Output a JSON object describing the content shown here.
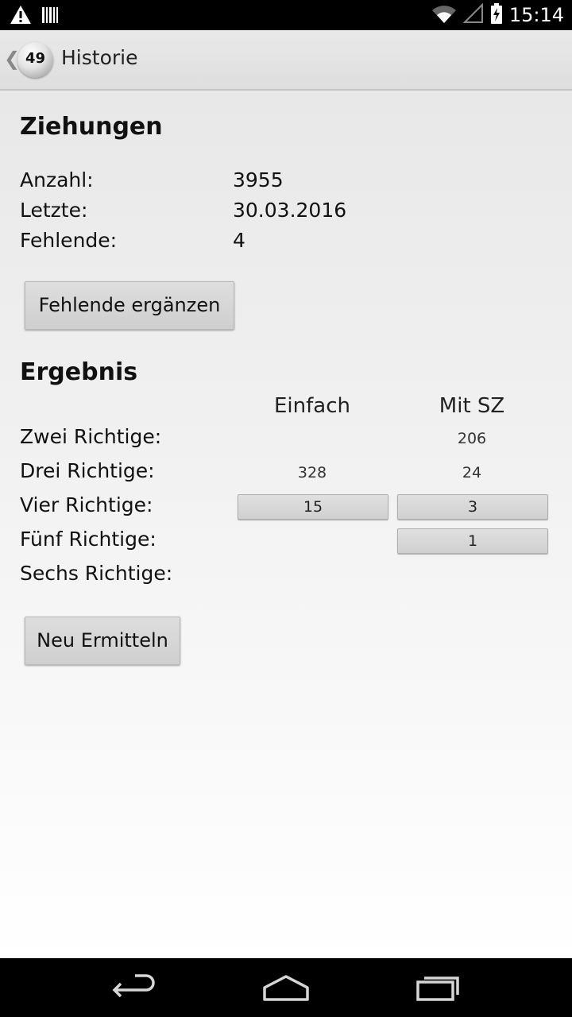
{
  "status_bar": {
    "time": "15:14",
    "icons": [
      "warning-icon",
      "barcode-icon",
      "wifi-icon",
      "signal-icon",
      "battery-icon"
    ]
  },
  "action_bar": {
    "logo_number": "49",
    "title": "Historie"
  },
  "ziehungen": {
    "title": "Ziehungen",
    "rows": [
      {
        "label": "Anzahl:",
        "value": "3955"
      },
      {
        "label": "Letzte:",
        "value": "30.03.2016"
      },
      {
        "label": "Fehlende:",
        "value": "4"
      }
    ],
    "button_label": "Fehlende ergänzen"
  },
  "ergebnis": {
    "title": "Ergebnis",
    "columns": [
      "Einfach",
      "Mit SZ"
    ],
    "rows": [
      {
        "label": "Zwei Richtige:",
        "einfach": "",
        "mit_sz": "206"
      },
      {
        "label": "Drei Richtige:",
        "einfach": "328",
        "mit_sz": "24"
      },
      {
        "label": "Vier Richtige:",
        "einfach": "15",
        "mit_sz": "3"
      },
      {
        "label": "Fünf Richtige:",
        "einfach": "",
        "mit_sz": "1"
      },
      {
        "label": "Sechs Richtige:",
        "einfach": "",
        "mit_sz": ""
      }
    ],
    "button_label": "Neu Ermitteln"
  },
  "nav_bar": {
    "icons": [
      "back-icon",
      "home-icon",
      "recent-apps-icon"
    ]
  }
}
